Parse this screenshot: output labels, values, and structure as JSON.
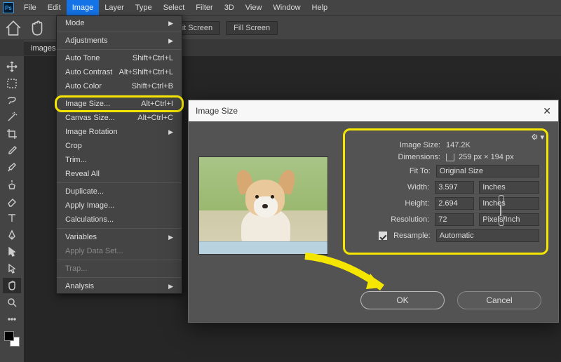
{
  "menubar": {
    "items": [
      "File",
      "Edit",
      "Image",
      "Layer",
      "Type",
      "Select",
      "Filter",
      "3D",
      "View",
      "Window",
      "Help"
    ],
    "active_index": 2
  },
  "optbar": {
    "fit_screen": "Fit Screen",
    "fill_screen": "Fill Screen"
  },
  "tabs": {
    "active": "images."
  },
  "dropdown": {
    "mode": "Mode",
    "adjustments": "Adjustments",
    "auto_tone": "Auto Tone",
    "auto_tone_sc": "Shift+Ctrl+L",
    "auto_contrast": "Auto Contrast",
    "auto_contrast_sc": "Alt+Shift+Ctrl+L",
    "auto_color": "Auto Color",
    "auto_color_sc": "Shift+Ctrl+B",
    "image_size": "Image Size...",
    "image_size_sc": "Alt+Ctrl+I",
    "canvas_size": "Canvas Size...",
    "canvas_size_sc": "Alt+Ctrl+C",
    "image_rotation": "Image Rotation",
    "crop": "Crop",
    "trim": "Trim...",
    "reveal_all": "Reveal All",
    "duplicate": "Duplicate...",
    "apply_image": "Apply Image...",
    "calculations": "Calculations...",
    "variables": "Variables",
    "apply_data_set": "Apply Data Set...",
    "trap": "Trap...",
    "analysis": "Analysis"
  },
  "dialog": {
    "title": "Image Size",
    "image_size_lbl": "Image Size:",
    "image_size_val": "147.2K",
    "dimensions_lbl": "Dimensions:",
    "dimensions_val": "259 px  ×  194 px",
    "fit_to_lbl": "Fit To:",
    "fit_to_val": "Original Size",
    "width_lbl": "Width:",
    "width_val": "3.597",
    "width_unit": "Inches",
    "height_lbl": "Height:",
    "height_val": "2.694",
    "height_unit": "Inches",
    "resolution_lbl": "Resolution:",
    "resolution_val": "72",
    "resolution_unit": "Pixels/Inch",
    "resample_lbl": "Resample:",
    "resample_val": "Automatic",
    "ok": "OK",
    "cancel": "Cancel"
  },
  "tool_names": [
    "move",
    "artboard",
    "lasso",
    "magic-wand",
    "crop",
    "eyedropper",
    "brush",
    "clone",
    "eraser",
    "type",
    "pen",
    "path-select",
    "arrow",
    "hand",
    "zoom",
    "more"
  ]
}
